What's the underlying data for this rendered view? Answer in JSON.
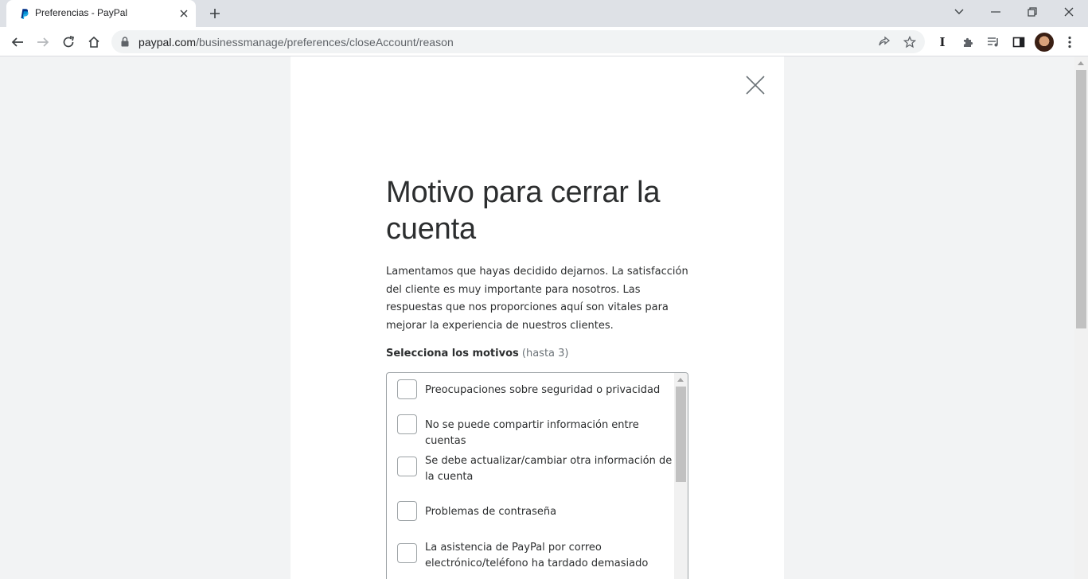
{
  "browser": {
    "tab_title": "Preferencias - PayPal",
    "url_host": "paypal.com",
    "url_path": "/businessmanage/preferences/closeAccount/reason",
    "extension_label": "I"
  },
  "page": {
    "title": "Motivo para cerrar la cuenta",
    "description": "Lamentamos que hayas decidido dejarnos. La satisfacción del cliente es muy importante para nosotros. Las respuestas que nos proporciones aquí son vitales para mejorar la experiencia de nuestros clientes.",
    "select_label": "Selecciona los motivos",
    "select_hint": "(hasta 3)",
    "reasons": [
      {
        "label": "Preocupaciones sobre seguridad o privacidad",
        "checked": false
      },
      {
        "label": "No se puede compartir información entre cuentas",
        "checked": false
      },
      {
        "label": "Se debe actualizar/cambiar otra información de la cuenta",
        "checked": false
      },
      {
        "label": "Problemas de contraseña",
        "checked": false
      },
      {
        "label": "La asistencia de PayPal por correo electrónico/teléfono ha tardado demasiado",
        "checked": false
      }
    ]
  },
  "colors": {
    "paypal_navy": "#003087",
    "paypal_blue": "#009cde",
    "text": "#2c2e2f",
    "page_bg": "#f2f3f4"
  },
  "icons": {
    "favicon": "paypal-logo-icon",
    "close": "close-icon",
    "lock": "lock-icon"
  }
}
